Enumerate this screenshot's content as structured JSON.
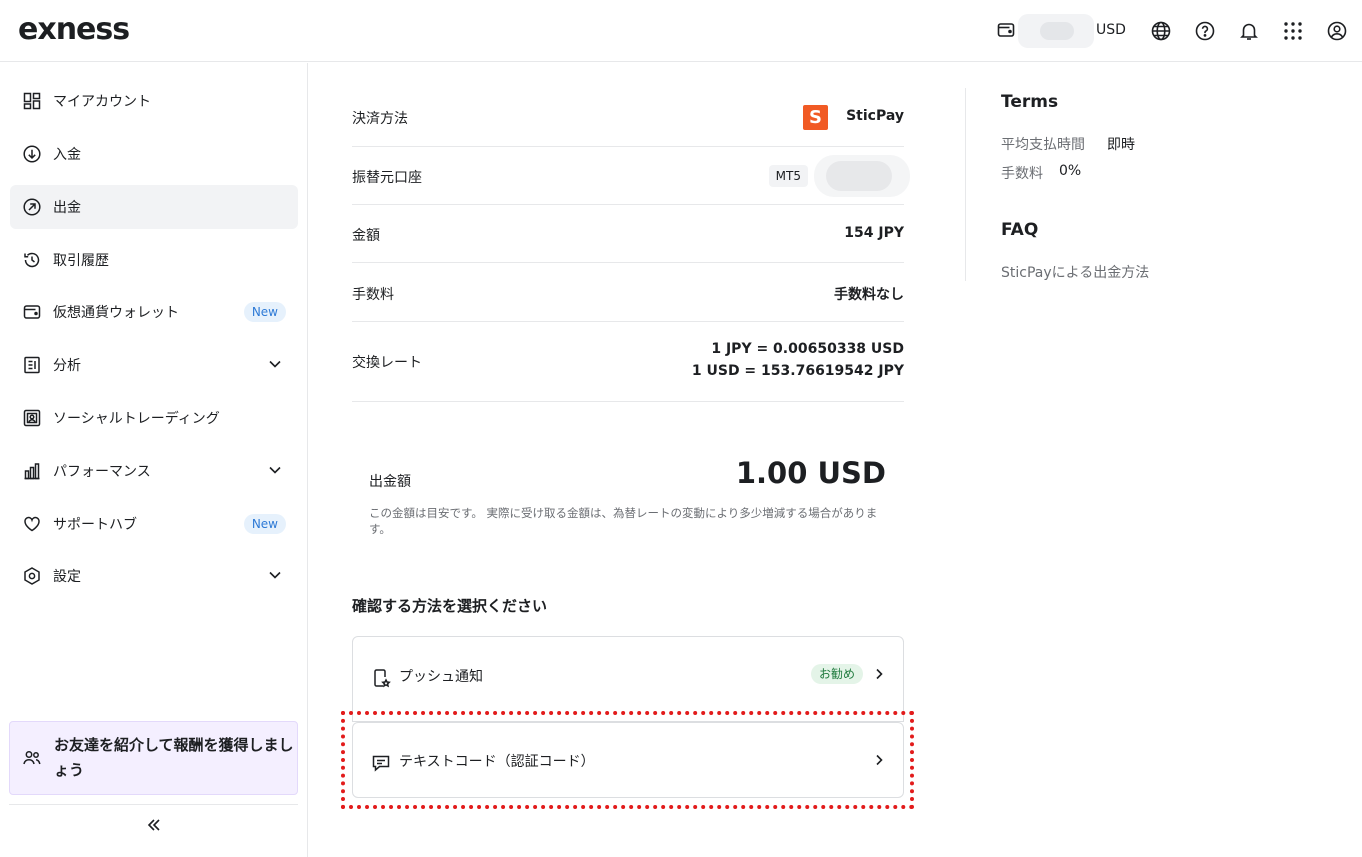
{
  "header": {
    "logo": "exness",
    "currency": "USD"
  },
  "sidebar": {
    "items": [
      {
        "label": "マイアカウント",
        "icon": "dashboard-icon"
      },
      {
        "label": "入金",
        "icon": "deposit-icon"
      },
      {
        "label": "出金",
        "icon": "withdraw-icon",
        "active": true
      },
      {
        "label": "取引履歴",
        "icon": "history-icon"
      },
      {
        "label": "仮想通貨ウォレット",
        "icon": "wallet-icon",
        "badge": "New"
      },
      {
        "label": "分析",
        "icon": "analytics-icon",
        "expandable": true
      },
      {
        "label": "ソーシャルトレーディング",
        "icon": "social-trading-icon"
      },
      {
        "label": "パフォーマンス",
        "icon": "performance-icon",
        "expandable": true
      },
      {
        "label": "サポートハブ",
        "icon": "heart-icon",
        "badge": "New"
      },
      {
        "label": "設定",
        "icon": "settings-icon",
        "expandable": true
      }
    ],
    "refer": "お友達を紹介して報酬を獲得しましょう"
  },
  "details": {
    "payment_method_label": "決済方法",
    "payment_method_value": "SticPay",
    "payment_logo_letter": "S",
    "source_account_label": "振替元口座",
    "source_account_badge": "MT5",
    "amount_label": "金額",
    "amount_value": "154 JPY",
    "fee_label": "手数料",
    "fee_value": "手数料なし",
    "rate_label": "交換レート",
    "rate_value_1": "1 JPY = 0.00650338 USD",
    "rate_value_2": "1 USD = 153.76619542 JPY"
  },
  "withdrawal": {
    "label": "出金額",
    "amount": "1.00 USD",
    "note": "この金額は目安です。 実際に受け取る金額は、為替レートの変動により多少増減する場合があります。"
  },
  "confirm": {
    "title": "確認する方法を選択ください",
    "methods": [
      {
        "label": "プッシュ通知",
        "badge": "お勧め"
      },
      {
        "label": "テキストコード（認証コード）"
      }
    ]
  },
  "terms": {
    "title": "Terms",
    "payout_time_label": "平均支払時間",
    "payout_time_value": "即時",
    "fee_label": "手数料",
    "fee_value": "0%"
  },
  "faq": {
    "title": "FAQ",
    "link": "SticPayによる出金方法"
  }
}
